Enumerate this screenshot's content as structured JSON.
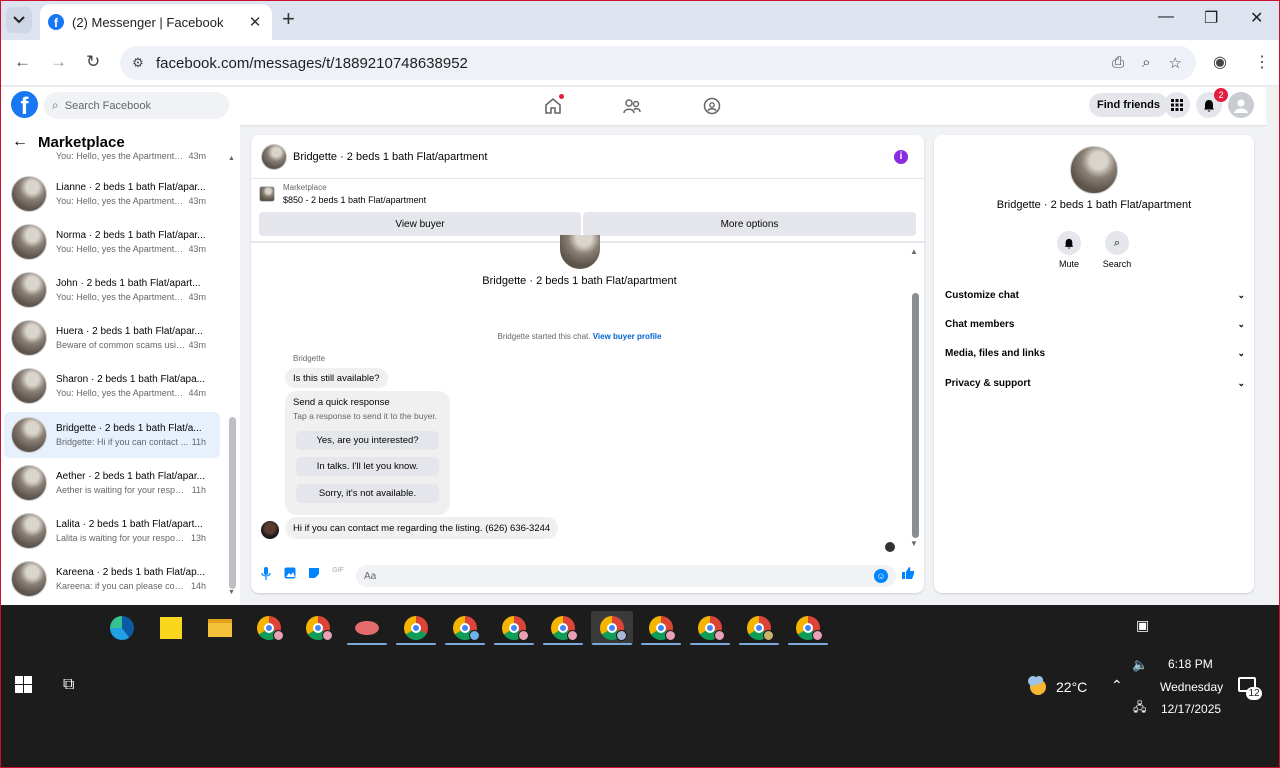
{
  "browser": {
    "tab_title": "(2) Messenger | Facebook",
    "url": "facebook.com/messages/t/1889210748638952"
  },
  "fb_header": {
    "search_placeholder": "Search Facebook",
    "find_friends": "Find friends",
    "notification_count": "2"
  },
  "sidebar": {
    "title": "Marketplace",
    "threads": [
      {
        "name": "Lianne · 2 beds 1 bath Flat/apar...",
        "preview": "You: Hello, yes the Apartment is ...",
        "time": "43m"
      },
      {
        "name": "Norma · 2 beds 1 bath Flat/apar...",
        "preview": "You: Hello, yes the Apartment is ...",
        "time": "43m"
      },
      {
        "name": "John · 2 beds 1 bath Flat/apart...",
        "preview": "You: Hello, yes the Apartment is ...",
        "time": "43m"
      },
      {
        "name": "Huera · 2 beds 1 bath Flat/apar...",
        "preview": "Beware of common scams using...",
        "time": "43m"
      },
      {
        "name": "Sharon · 2 beds 1 bath Flat/apa...",
        "preview": "You: Hello, yes the Apartment is ...",
        "time": "44m"
      },
      {
        "name": "Bridgette · 2 beds 1 bath Flat/a...",
        "preview": "Bridgette: Hi if you can contact ...",
        "time": "11h"
      },
      {
        "name": "Aether · 2 beds 1 bath Flat/apar...",
        "preview": "Aether is waiting for your respon...",
        "time": "11h"
      },
      {
        "name": "Lalita · 2 beds 1 bath Flat/apart...",
        "preview": "Lalita is waiting for your response.",
        "time": "13h"
      },
      {
        "name": "Kareena · 2 beds 1 bath Flat/ap...",
        "preview": "Kareena: if you can please conta...",
        "time": "14h"
      }
    ],
    "partial_top": "You: Hello, yes the Apartment is ...",
    "partial_top_time": "43m"
  },
  "chat": {
    "header_title": "Bridgette · 2 beds 1 bath Flat/apartment",
    "marketplace_label": "Marketplace",
    "listing_price": "$850 - 2 beds 1 bath Flat/apartment",
    "view_buyer": "View buyer",
    "more_options": "More options",
    "listing_name": "Bridgette · 2 beds 1 bath Flat/apartment",
    "started_text": "Bridgette started this chat.",
    "view_profile": "View buyer profile",
    "sender_name": "Bridgette",
    "first_message": "Is this still available?",
    "quick_title": "Send a quick response",
    "quick_sub": "Tap a response to send it to the buyer.",
    "quick_responses": [
      "Yes, are you interested?",
      "In talks. I'll let you know.",
      "Sorry, it's not available."
    ],
    "last_message": "Hi if you can contact me regarding the listing. (626) 636-3244",
    "composer_placeholder": "Aa"
  },
  "info_panel": {
    "name": "Bridgette · 2 beds 1 bath Flat/apartment",
    "mute": "Mute",
    "search": "Search",
    "sections": [
      "Customize chat",
      "Chat members",
      "Media, files and links",
      "Privacy & support"
    ]
  },
  "taskbar": {
    "temperature": "22°C",
    "time": "6:18 PM",
    "day": "Wednesday",
    "date": "12/17/2025",
    "notifications": "12"
  }
}
